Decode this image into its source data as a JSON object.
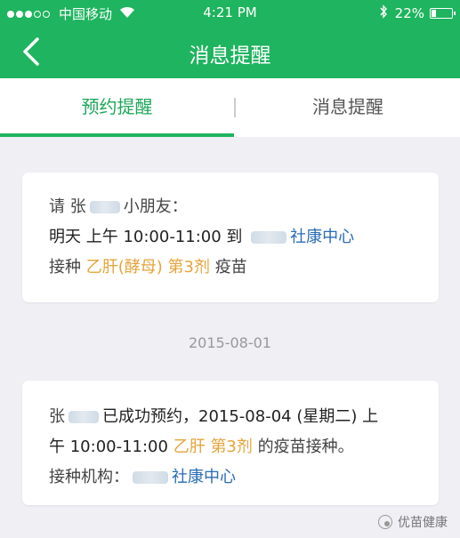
{
  "status_bar": {
    "carrier": "中国移动",
    "time": "4:21 PM",
    "battery": "22%"
  },
  "navbar": {
    "title": "消息提醒"
  },
  "tabs": [
    {
      "label": "预约提醒",
      "active": true
    },
    {
      "label": "消息提醒",
      "active": false
    }
  ],
  "card1": {
    "greeting_prefix": "请 张",
    "greeting_suffix": "小朋友：",
    "time_text": "明天 上午 10:00-11:00 到",
    "clinic": "社康中心",
    "vaccinate_prefix": "接种",
    "vaccine_name": "乙肝(酵母) 第3剂",
    "vaccinate_suffix": "疫苗"
  },
  "date_separator": "2015-08-01",
  "card2": {
    "name_prefix": "张",
    "line1_text": "已成功预约，2015-08-04 (星期二) 上",
    "line2_prefix": "午 10:00-11:00",
    "vaccine_a": "乙肝",
    "vaccine_b": "第3剂",
    "line2_suffix": "的疫苗接种。",
    "org_label": "接种机构：",
    "org_name": "社康中心"
  },
  "watermark": {
    "text": "优苗健康"
  },
  "colors": {
    "brand_green": "#1fb45f",
    "accent_orange": "#e6a43b",
    "link_blue": "#2a6cb8"
  }
}
